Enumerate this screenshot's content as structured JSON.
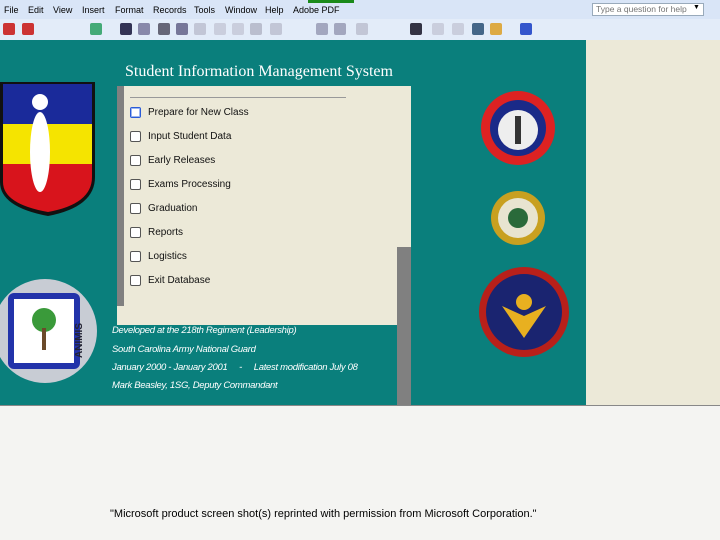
{
  "menubar": {
    "items": [
      "File",
      "Edit",
      "View",
      "Insert",
      "Format",
      "Records",
      "Tools",
      "Window",
      "Help",
      "Adobe PDF"
    ],
    "help_placeholder": "Type a question for help"
  },
  "toolbar": {
    "icons": [
      "pdf-icon",
      "pdf-settings-icon",
      "view-icon",
      "save-icon",
      "copy-icon",
      "print-icon",
      "print-preview-icon",
      "spelling-icon",
      "cut-icon",
      "paste-icon",
      "undo-icon",
      "hyperlink-icon",
      "sort-asc-icon",
      "sort-desc-icon",
      "filter-icon",
      "find-icon",
      "new-record-icon",
      "delete-record-icon",
      "database-icon",
      "new-object-icon",
      "help-icon"
    ]
  },
  "app": {
    "title": "Student Information Management System",
    "menu_items": [
      {
        "label": "Prepare for New Class",
        "selected": true
      },
      {
        "label": "Input Student Data"
      },
      {
        "label": "Early Releases"
      },
      {
        "label": "Exams Processing"
      },
      {
        "label": "Graduation"
      },
      {
        "label": "Reports"
      },
      {
        "label": "Logistics"
      },
      {
        "label": "Exit Database"
      }
    ],
    "credits": [
      "Developed at the 218th Regiment (Leadership)",
      "South Carolina Army National Guard",
      "January 2000 - January 2001     -     Latest modification July 08",
      "Mark Beasley, 1SG, Deputy Commandant"
    ],
    "logos": {
      "national_guard": "ARMY NATIONAL GUARD",
      "army_reserve": "UNITED STATES ARMY RESERVE",
      "left_seal": "ANIMIS"
    }
  },
  "colors": {
    "background": "#0a7f7c",
    "panel": "#ece9d8"
  },
  "footer": "\"Microsoft product screen shot(s) reprinted with permission from Microsoft Corporation.\""
}
